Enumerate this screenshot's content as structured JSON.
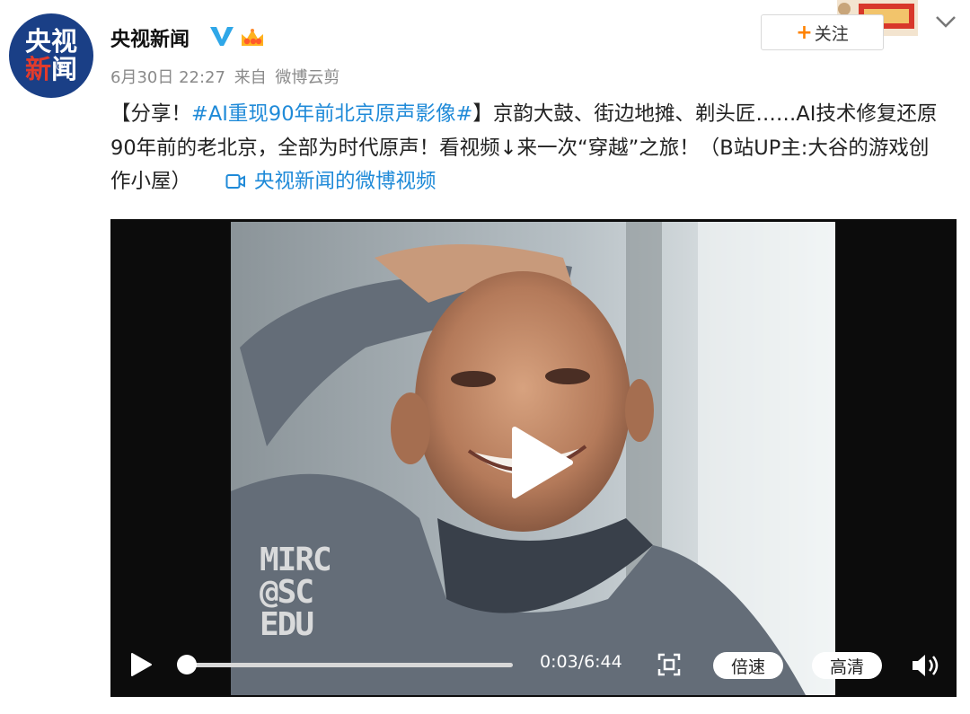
{
  "account": {
    "avatar_text_line1": "央视",
    "avatar_text_line2a": "新",
    "avatar_text_line2b": "闻",
    "avatar_at": "@",
    "name": "央视新闻",
    "verified_icon": "verified-v-icon",
    "member_icon": "vip-crown-icon"
  },
  "meta": {
    "date": "6月30日 22:27",
    "source_prefix": "来自",
    "source": "微博云剪"
  },
  "follow_button": {
    "plus": "+",
    "label": "关注"
  },
  "post": {
    "prefix": "【分享！",
    "hashtag": "#AI重现90年前北京原声影像#",
    "body": "】京韵大鼓、街边地摊、剃头匠……AI技术修复还原90年前的老北京，全部为时代原声！看视频↓来一次“穿越”之旅！（B站UP主:大谷的游戏创作小屋）",
    "video_link": "央视新闻的微博视频"
  },
  "video": {
    "watermark_lines": [
      "MIRC",
      "@SC",
      "EDU"
    ],
    "current_time": "0:03",
    "duration": "6:44",
    "time_display": "0:03/6:44",
    "progress": 0.0074,
    "speed_label": "倍速",
    "quality_label": "高清"
  },
  "colors": {
    "link": "#1f8ad8",
    "follow_plus": "#ff8200",
    "avatar_bg": "#1a3f86"
  }
}
